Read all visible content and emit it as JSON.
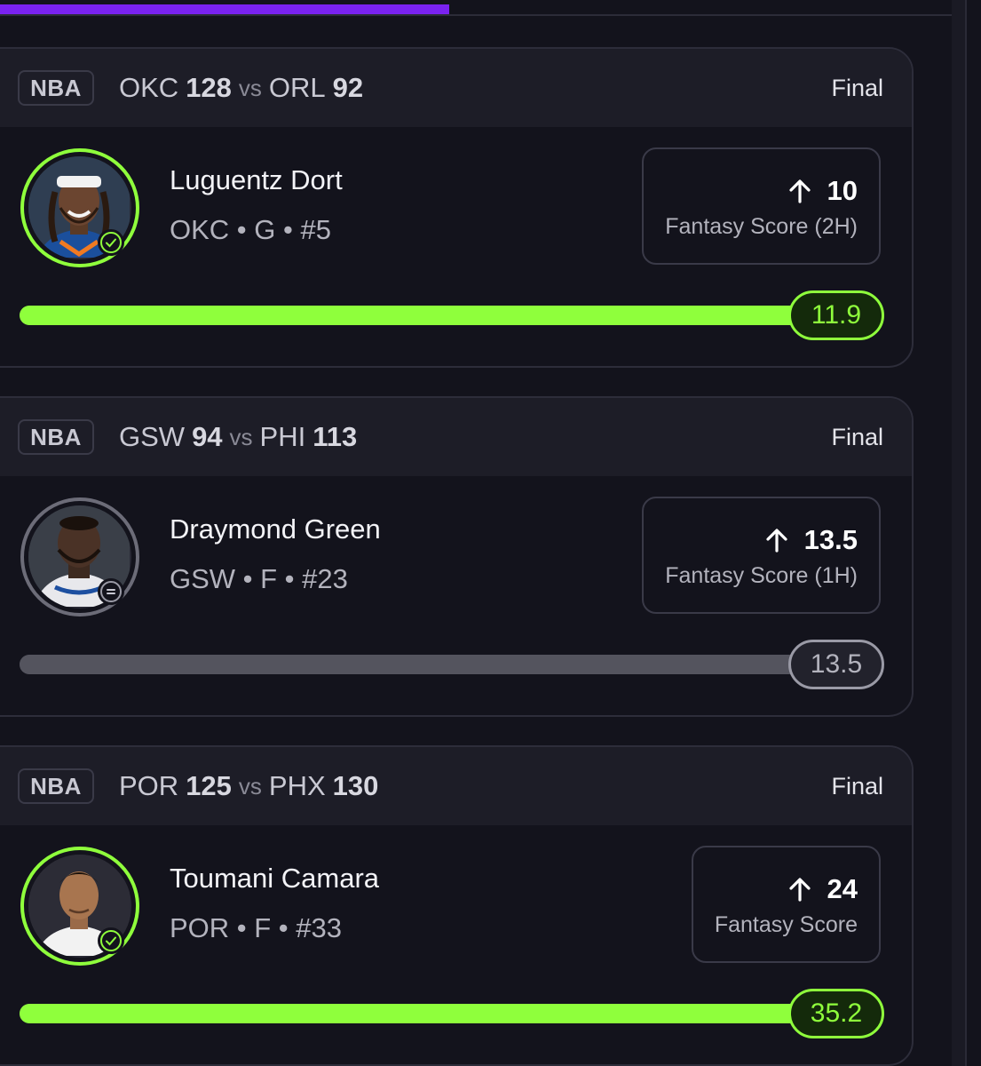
{
  "colors": {
    "accent_purple": "#7a22f0",
    "win_green": "#8fff3c",
    "push_gray": "#9a9aa6",
    "background": "#13131c"
  },
  "top_progress": {
    "fraction": 0.46
  },
  "cards": [
    {
      "league": "NBA",
      "away_team": "OKC",
      "away_score": "128",
      "vs": "vs",
      "home_team": "ORL",
      "home_score": "92",
      "status": "Final",
      "player_name": "Luguentz Dort",
      "player_info": "OKC • G • #5",
      "direction_icon": "arrow-up-icon",
      "line_value": "10",
      "line_label": "Fantasy Score (2H)",
      "result_value": "11.9",
      "result_state": "win",
      "status_icon": "check-icon",
      "bar_fraction": 1.0
    },
    {
      "league": "NBA",
      "away_team": "GSW",
      "away_score": "94",
      "vs": "vs",
      "home_team": "PHI",
      "home_score": "113",
      "status": "Final",
      "player_name": "Draymond Green",
      "player_info": "GSW • F • #23",
      "direction_icon": "arrow-up-icon",
      "line_value": "13.5",
      "line_label": "Fantasy Score (1H)",
      "result_value": "13.5",
      "result_state": "push",
      "status_icon": "equals-icon",
      "bar_fraction": 1.0
    },
    {
      "league": "NBA",
      "away_team": "POR",
      "away_score": "125",
      "vs": "vs",
      "home_team": "PHX",
      "home_score": "130",
      "status": "Final",
      "player_name": "Toumani Camara",
      "player_info": "POR • F • #33",
      "direction_icon": "arrow-up-icon",
      "line_value": "24",
      "line_label": "Fantasy Score",
      "result_value": "35.2",
      "result_state": "win",
      "status_icon": "check-icon",
      "bar_fraction": 1.0
    }
  ]
}
